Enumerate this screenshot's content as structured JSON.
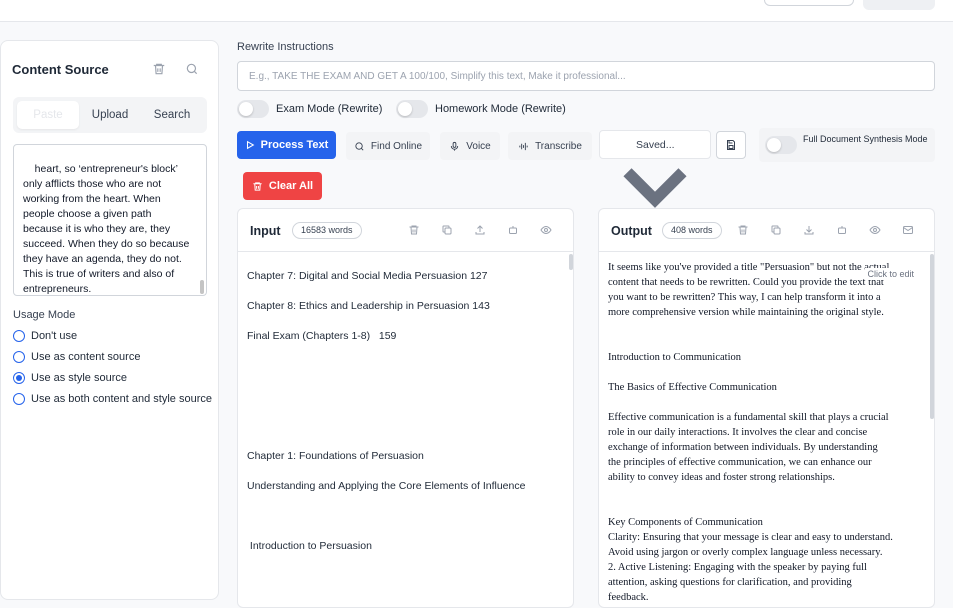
{
  "content_source": {
    "title": "Content Source",
    "tabs": [
      "Paste",
      "Upload",
      "Search"
    ],
    "text": "heart, so ‘entrepreneur's block’ only afflicts those who are not working from the heart. When people choose a given path because it is who they are, they succeed. When they do so because they have an agenda, they do not.\nThis is true of writers and also of entrepreneurs.",
    "usage_label": "Usage Mode",
    "usage_options": [
      "Don't use",
      "Use as content source",
      "Use as style source",
      "Use as both content and style source"
    ],
    "usage_selected": "Use as style source"
  },
  "rewrite": {
    "label": "Rewrite Instructions",
    "placeholder": "E.g., TAKE THE EXAM AND GET A 100/100, Simplify this text, Make it professional...",
    "exam_mode": "Exam Mode (Rewrite)",
    "homework_mode": "Homework Mode (Rewrite)"
  },
  "toolbar": {
    "process": "Process Text",
    "find_online": "Find Online",
    "voice": "Voice",
    "transcribe": "Transcribe",
    "saved": "Saved...",
    "synthesis": "Full Document Synthesis Mode",
    "clear_all": "Clear All"
  },
  "input_panel": {
    "title": "Input",
    "count": "16583 words",
    "lines": [
      "Chapter 7: Digital and Social Media Persuasion 127",
      "Chapter 8: Ethics and Leadership in Persuasion 143",
      "Final Exam (Chapters 1-8)   159",
      "Chapter 1: Foundations of Persuasion",
      "Understanding and Applying the Core Elements of Influence",
      " Introduction to Persuasion"
    ]
  },
  "output_panel": {
    "title": "Output",
    "count": "408 words",
    "click_to_edit": "Click to edit",
    "blocks": [
      "It seems like you've provided a title \"Persuasion\" but not the actual content that needs to be rewritten. Could you provide the text that you want to be rewritten? This way, I can help transform it into a more comprehensive version while maintaining the original style.",
      "Introduction to Communication",
      "The Basics of Effective Communication",
      "Effective communication is a fundamental skill that plays a crucial role in our daily interactions. It involves the clear and concise exchange of information between individuals. By understanding the principles of effective communication, we can enhance our ability to convey ideas and foster strong relationships.",
      "Key Components of Communication\nClarity: Ensuring that your message is clear and easy to understand. Avoid using jargon or overly complex language unless necessary.     2. Active Listening: Engaging with the speaker by paying full attention, asking questions for clarification, and providing feedback."
    ]
  },
  "colors": {
    "primary": "#2563eb",
    "danger": "#ef4444"
  }
}
